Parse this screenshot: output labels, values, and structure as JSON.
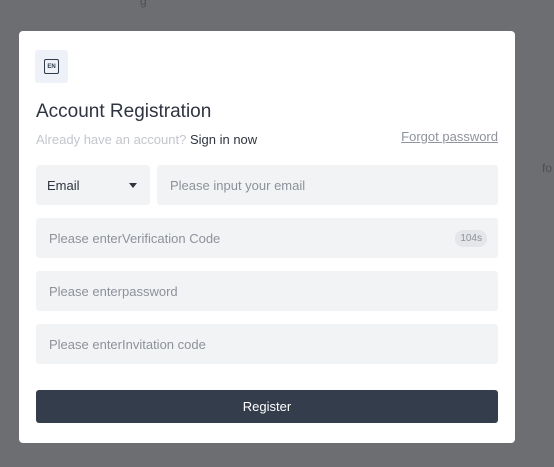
{
  "background": {
    "top_fragment": "g",
    "right_fragment": "fo"
  },
  "modal": {
    "language_badge": "EN",
    "title": "Account Registration",
    "already_have_account": "Already have an account?",
    "sign_in_now": "Sign in now",
    "forgot_password": "Forgot password",
    "account_type": {
      "selected": "Email",
      "icon": "chevron-down-icon"
    },
    "email_field": {
      "value": "",
      "placeholder": "Please input your email"
    },
    "verification_field": {
      "value": "",
      "placeholder": "Please enterVerification Code",
      "countdown": "104s"
    },
    "password_field": {
      "value": "",
      "placeholder": "Please enterpassword"
    },
    "invitation_field": {
      "value": "",
      "placeholder": "Please enterInvitation code"
    },
    "register_label": "Register"
  },
  "colors": {
    "overlay": "#6d6e71",
    "modal_bg": "#ffffff",
    "field_bg": "#f2f3f5",
    "button_bg": "#343d4b",
    "text_dark": "#2f3440",
    "text_muted": "#c3c6cc",
    "placeholder": "#8d9199"
  }
}
